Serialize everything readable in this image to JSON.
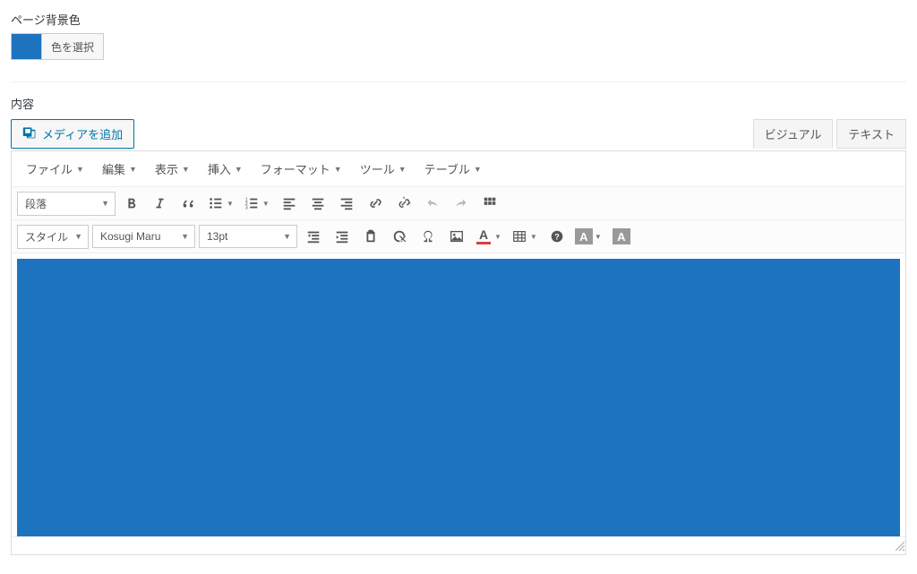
{
  "color_section": {
    "label": "ページ背景色",
    "select_button": "色を選択",
    "swatch_color": "#1e73be"
  },
  "content_section": {
    "label": "内容",
    "add_media_button": "メディアを追加"
  },
  "tabs": {
    "visual": "ビジュアル",
    "text": "テキスト"
  },
  "menubar": {
    "file": "ファイル",
    "edit": "編集",
    "view": "表示",
    "insert": "挿入",
    "format": "フォーマット",
    "tools": "ツール",
    "table": "テーブル"
  },
  "toolbar1": {
    "block_format": "段落"
  },
  "toolbar2": {
    "style": "スタイル",
    "font": "Kosugi Maru",
    "size": "13pt"
  },
  "colors": {
    "text_color_bar": "#d84040",
    "accent_blue": "#1e73be"
  }
}
